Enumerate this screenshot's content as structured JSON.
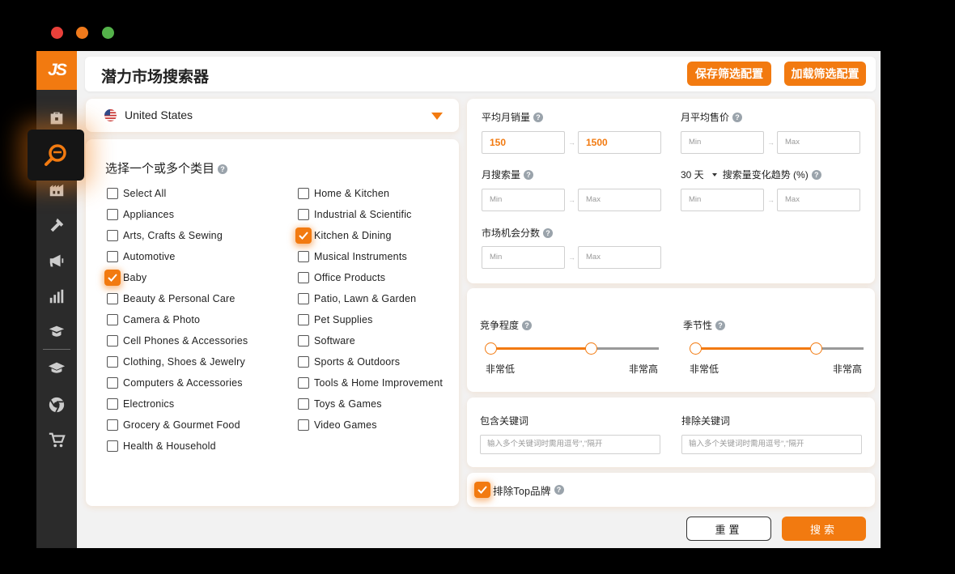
{
  "app": {
    "logo": "JS",
    "title": "潜力市场搜索器",
    "save_config": "保存筛选配置",
    "load_config": "加载筛选配置"
  },
  "sidebar": {
    "items": [
      "dashboard-icon",
      "market-search-icon",
      "warehouse-icon",
      "hammer-icon",
      "megaphone-icon",
      "bar-chart-icon",
      "graduation-hat-icon",
      "academy-icon",
      "chrome-icon",
      "cart-icon"
    ],
    "active": "market-search-icon"
  },
  "country": {
    "selected": "United States"
  },
  "categories": {
    "title": "选择一个或多个类目",
    "col1": [
      {
        "label": "Select All",
        "checked": false
      },
      {
        "label": "Appliances",
        "checked": false
      },
      {
        "label": "Arts, Crafts & Sewing",
        "checked": false
      },
      {
        "label": "Automotive",
        "checked": false
      },
      {
        "label": "Baby",
        "checked": true
      },
      {
        "label": "Beauty & Personal Care",
        "checked": false
      },
      {
        "label": "Camera & Photo",
        "checked": false
      },
      {
        "label": "Cell Phones & Accessories",
        "checked": false
      },
      {
        "label": "Clothing, Shoes & Jewelry",
        "checked": false
      },
      {
        "label": "Computers & Accessories",
        "checked": false
      },
      {
        "label": "Electronics",
        "checked": false
      },
      {
        "label": "Grocery & Gourmet Food",
        "checked": false
      },
      {
        "label": "Health & Household",
        "checked": false
      }
    ],
    "col2": [
      {
        "label": "Home & Kitchen",
        "checked": false
      },
      {
        "label": "Industrial & Scientific",
        "checked": false
      },
      {
        "label": "Kitchen & Dining",
        "checked": true
      },
      {
        "label": "Musical Instruments",
        "checked": false
      },
      {
        "label": "Office Products",
        "checked": false
      },
      {
        "label": "Patio, Lawn & Garden",
        "checked": false
      },
      {
        "label": "Pet Supplies",
        "checked": false
      },
      {
        "label": "Software",
        "checked": false
      },
      {
        "label": "Sports & Outdoors",
        "checked": false
      },
      {
        "label": "Tools & Home Improvement",
        "checked": false
      },
      {
        "label": "Toys & Games",
        "checked": false
      },
      {
        "label": "Video Games",
        "checked": false
      }
    ]
  },
  "filters": {
    "avg_monthly_sales": {
      "label": "平均月销量",
      "min": "150",
      "max": "1500"
    },
    "avg_monthly_price": {
      "label": "月平均售价",
      "min_placeholder": "Min",
      "max_placeholder": "Max"
    },
    "monthly_search": {
      "label": "月搜索量",
      "min_placeholder": "Min",
      "max_placeholder": "Max"
    },
    "search_trend": {
      "period": "30 天",
      "label": "搜索量变化趋势 (%)",
      "min_placeholder": "Min",
      "max_placeholder": "Max"
    },
    "opportunity_score": {
      "label": "市场机会分数",
      "min_placeholder": "Min",
      "max_placeholder": "Max"
    }
  },
  "sliders": {
    "competition": {
      "label": "竞争程度",
      "low": "非常低",
      "high": "非常高",
      "range": [
        0,
        0.6
      ]
    },
    "seasonality": {
      "label": "季节性",
      "low": "非常低",
      "high": "非常高",
      "range": [
        0,
        0.72
      ]
    }
  },
  "keywords": {
    "include": {
      "label": "包含关键词",
      "placeholder": "输入多个关键词时需用逗号\",\"隔开"
    },
    "exclude": {
      "label": "排除关键词",
      "placeholder": "输入多个关键词时需用逗号\",\"隔开"
    }
  },
  "exclude_top_brand": {
    "label": "排除Top品牌",
    "checked": true
  },
  "actions": {
    "reset": "重置",
    "search": "搜索"
  },
  "colors": {
    "accent": "#f27a10",
    "sidebar": "#2b2b2b"
  }
}
